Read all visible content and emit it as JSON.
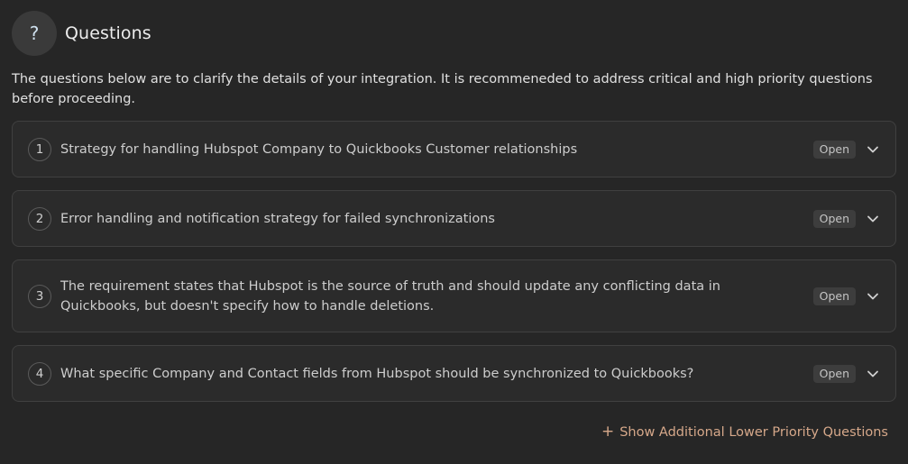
{
  "header": {
    "icon": "help-icon",
    "icon_glyph": "?",
    "title": "Questions"
  },
  "intro": "The questions below are to clarify the details of your integration. It is recommeneded to address critical and high priority questions before proceeding.",
  "questions": [
    {
      "number": "1",
      "text": "Strategy for handling Hubspot Company to Quickbooks Customer relationships",
      "status": "Open"
    },
    {
      "number": "2",
      "text": "Error handling and notification strategy for failed synchronizations",
      "status": "Open"
    },
    {
      "number": "3",
      "text": "The requirement states that Hubspot is the source of truth and should update any conflicting data in Quickbooks, but doesn't specify how to handle deletions.",
      "status": "Open"
    },
    {
      "number": "4",
      "text": "What specific Company and Contact fields from Hubspot should be synchronized to Quickbooks?",
      "status": "Open"
    }
  ],
  "more_button": {
    "icon": "plus-icon",
    "icon_glyph": "+",
    "label": "Show Additional Lower Priority Questions"
  },
  "colors": {
    "background": "#262626",
    "card": "#2b2b2b",
    "accent": "#d6a88a"
  }
}
